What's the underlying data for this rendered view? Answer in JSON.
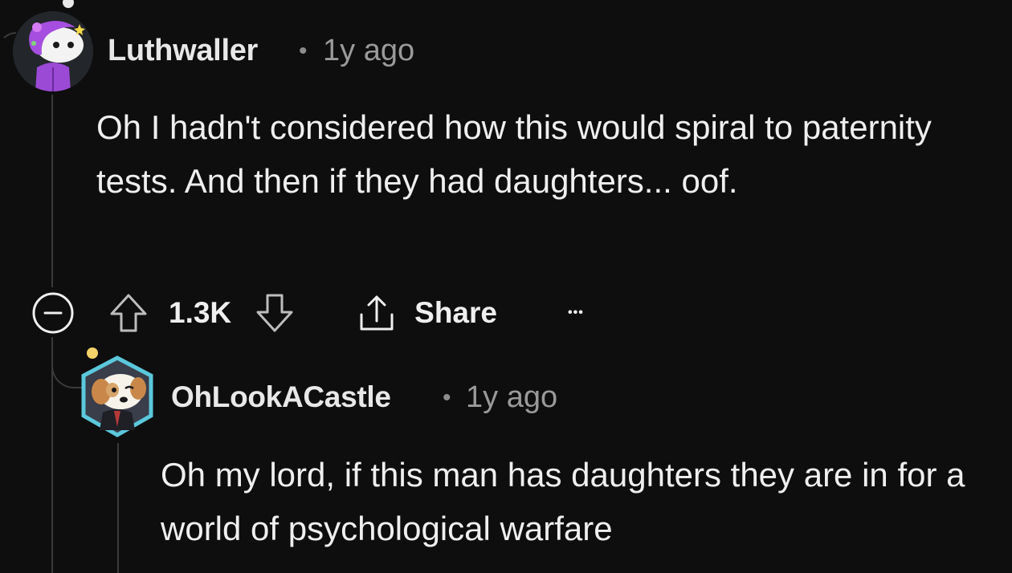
{
  "comments": [
    {
      "username": "Luthwaller",
      "separator": "•",
      "time": "1y ago",
      "body": "Oh I hadn't considered how this would spiral to paternity tests. And then if they had daughters... oof.",
      "score": "1.3K",
      "share_label": "Share",
      "more_label": "•••"
    },
    {
      "username": "OhLookACastle",
      "separator": "•",
      "time": "1y ago",
      "body": "Oh my lord, if this man has daughters they are in for a world of psychological warfare"
    }
  ],
  "colors": {
    "background": "#0e0e0e",
    "thread_line": "#3a3a3a",
    "text": "#efefef",
    "muted": "#9a9a9a",
    "avatar1_accent": "#8b3fc9",
    "avatar2_accent": "#4fc3d6"
  }
}
